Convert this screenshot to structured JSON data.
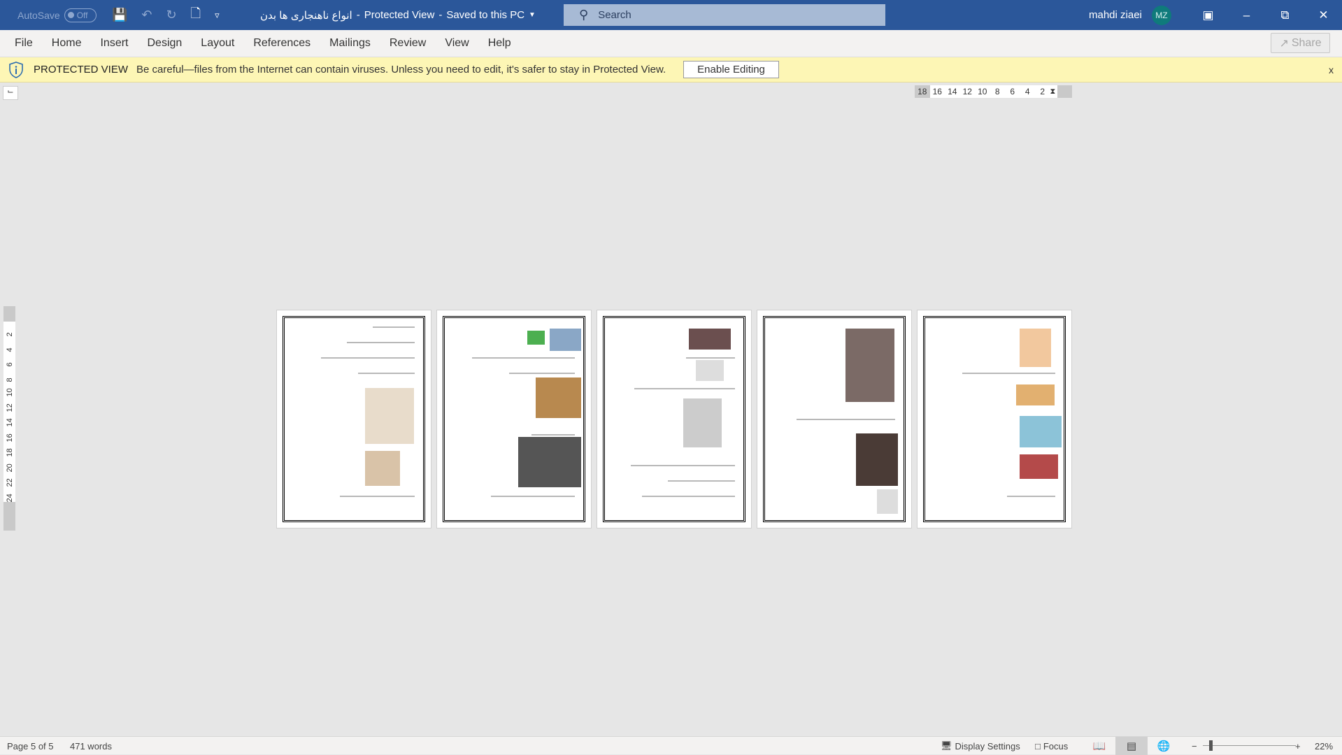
{
  "titlebar": {
    "autosave_label": "AutoSave",
    "autosave_state": "Off",
    "document_title": "انواع ناهنجاری ها بدن",
    "status_1": "Protected View",
    "status_2": "Saved to this PC",
    "search_placeholder": "Search",
    "user_name": "mahdi ziaei",
    "user_initials": "MZ",
    "avatar_color": "#0f7b7b",
    "bar_color": "#2b579a"
  },
  "menu": {
    "items": [
      "File",
      "Home",
      "Insert",
      "Design",
      "Layout",
      "References",
      "Mailings",
      "Review",
      "View",
      "Help"
    ],
    "share_label": "Share"
  },
  "protected": {
    "label": "PROTECTED VIEW",
    "message": "Be careful—files from the Internet can contain viruses. Unless you need to edit, it's safer to stay in Protected View.",
    "button": "Enable Editing",
    "close": "x"
  },
  "ruler": {
    "horizontal": [
      "18",
      "16",
      "14",
      "12",
      "10",
      "8",
      "6",
      "4",
      "2"
    ],
    "vertical": [
      "2",
      "2",
      "4",
      "6",
      "8",
      "10",
      "12",
      "14",
      "16",
      "18",
      "20",
      "22",
      "24"
    ]
  },
  "status": {
    "page": "Page 5 of 5",
    "words": "471 words",
    "display_settings": "Display Settings",
    "focus": "Focus",
    "zoom": "22%",
    "zoom_percent": 22
  }
}
